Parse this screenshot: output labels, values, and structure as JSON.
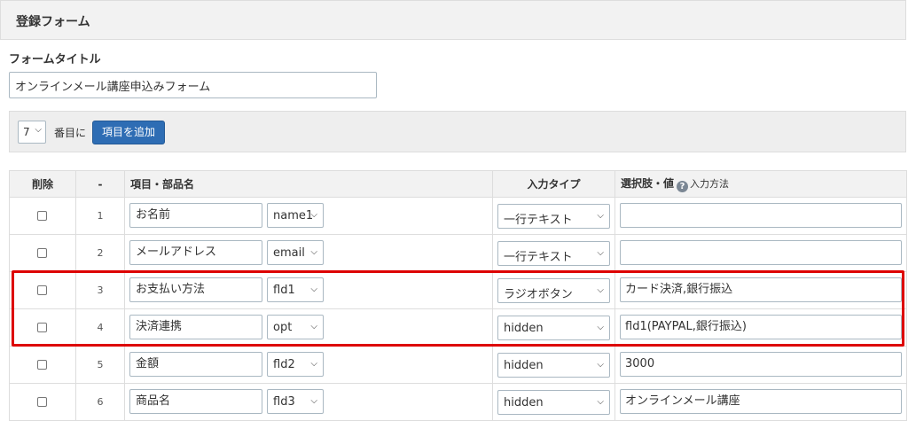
{
  "panel": {
    "title": "登録フォーム"
  },
  "form": {
    "title_label": "フォームタイトル",
    "title_value": "オンラインメール講座申込みフォーム"
  },
  "toolbar": {
    "position_value": "7",
    "position_label": "番目に",
    "add_button_label": "項目を追加"
  },
  "table": {
    "headers": {
      "delete": "削除",
      "number": "-",
      "name": "項目・部品名",
      "type": "入力タイプ",
      "values": "選択肢・値",
      "input_method": "入力方法"
    },
    "rows": [
      {
        "number": "1",
        "name": "お名前",
        "code": "name1",
        "type": "一行テキスト",
        "value": ""
      },
      {
        "number": "2",
        "name": "メールアドレス",
        "code": "email",
        "type": "一行テキスト",
        "value": ""
      },
      {
        "number": "3",
        "name": "お支払い方法",
        "code": "fld1",
        "type": "ラジオボタン",
        "value": "カード決済,銀行振込"
      },
      {
        "number": "4",
        "name": "決済連携",
        "code": "opt",
        "type": "hidden",
        "value": "fld1(PAYPAL,銀行振込)"
      },
      {
        "number": "5",
        "name": "金額",
        "code": "fld2",
        "type": "hidden",
        "value": "3000"
      },
      {
        "number": "6",
        "name": "商品名",
        "code": "fld3",
        "type": "hidden",
        "value": "オンラインメール講座"
      }
    ]
  },
  "highlight": {
    "color": "#dd0000",
    "rows": [
      "3",
      "4"
    ]
  },
  "colors": {
    "primary_button": "#2e6db4",
    "header_bg": "#f2f2f2",
    "border": "#dddddd"
  }
}
